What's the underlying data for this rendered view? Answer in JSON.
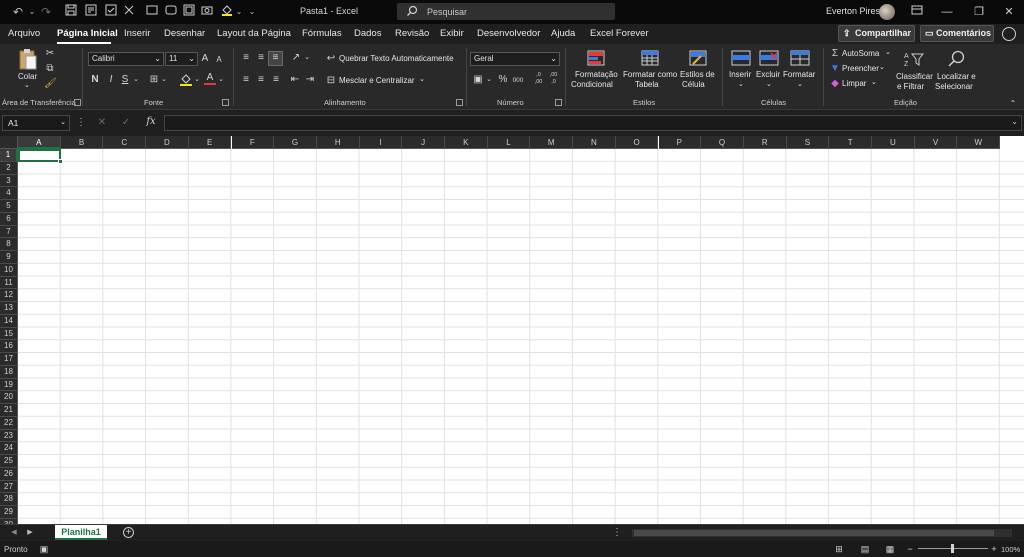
{
  "titlebar": {
    "file_title": "Pasta1  -  Excel",
    "search_placeholder": "Pesquisar",
    "user_name": "Everton Pires",
    "undo_icon": "↶",
    "redo_icon": "↷",
    "min": "—",
    "restore": "❐",
    "close": "✕"
  },
  "tabs": [
    "Arquivo",
    "Página Inicial",
    "Inserir",
    "Desenhar",
    "Layout da Página",
    "Fórmulas",
    "Dados",
    "Revisão",
    "Exibir",
    "Desenvolvedor",
    "Ajuda",
    "Excel Forever"
  ],
  "active_tab": "Página Inicial",
  "share_label": "Compartilhar",
  "comments_label": "Comentários",
  "ribbon": {
    "clipboard": {
      "paste": "Colar",
      "label": "Área de Transferência"
    },
    "font": {
      "name": "Calibri",
      "size": "11",
      "bold": "N",
      "italic": "I",
      "underline": "S",
      "label": "Fonte",
      "grow": "A",
      "shrink": "A"
    },
    "alignment": {
      "wrap": "Quebrar Texto Automaticamente",
      "merge": "Mesclar e Centralizar",
      "label": "Alinhamento"
    },
    "number": {
      "format": "Geral",
      "percent": "%",
      "thousands": "000",
      "inc_dec": ",0 ,00",
      "dec_dec": ",00 ,0",
      "label": "Número"
    },
    "styles": {
      "conditional": [
        "Formatação",
        "Condicional"
      ],
      "table": [
        "Formatar como",
        "Tabela"
      ],
      "cell": [
        "Estilos de",
        "Célula"
      ],
      "label": "Estilos"
    },
    "cells": {
      "insert": "Inserir",
      "delete": "Excluir",
      "format": "Formatar",
      "label": "Células"
    },
    "editing": {
      "autosum": "AutoSoma",
      "fill": "Preencher",
      "clear": "Limpar",
      "sort": [
        "Classificar",
        "e Filtrar"
      ],
      "find": [
        "Localizar e",
        "Selecionar"
      ],
      "label": "Edição"
    }
  },
  "formula_bar": {
    "name_box": "A1",
    "fx": "fx",
    "cancel": "✕",
    "enter": "✓",
    "more": "⋮"
  },
  "columns": [
    "A",
    "B",
    "C",
    "D",
    "E",
    "F",
    "G",
    "H",
    "I",
    "J",
    "K",
    "L",
    "M",
    "N",
    "O",
    "P",
    "Q",
    "R",
    "S",
    "T",
    "U",
    "V",
    "W"
  ],
  "rows": [
    "1",
    "2",
    "3",
    "4",
    "5",
    "6",
    "7",
    "8",
    "9",
    "10",
    "11",
    "12",
    "13",
    "14",
    "15",
    "16",
    "17",
    "18",
    "19",
    "20",
    "21",
    "22",
    "23",
    "24",
    "25",
    "26",
    "27",
    "28",
    "29",
    "30"
  ],
  "selected_cell": "A1",
  "sheet": {
    "name": "Planilha1",
    "add": "+"
  },
  "status": {
    "text": "Pronto",
    "zoom": "100%",
    "zoom_fraction": 0.5
  },
  "colors": {
    "accent": "#1e7145",
    "background": "#1f1f1f"
  }
}
